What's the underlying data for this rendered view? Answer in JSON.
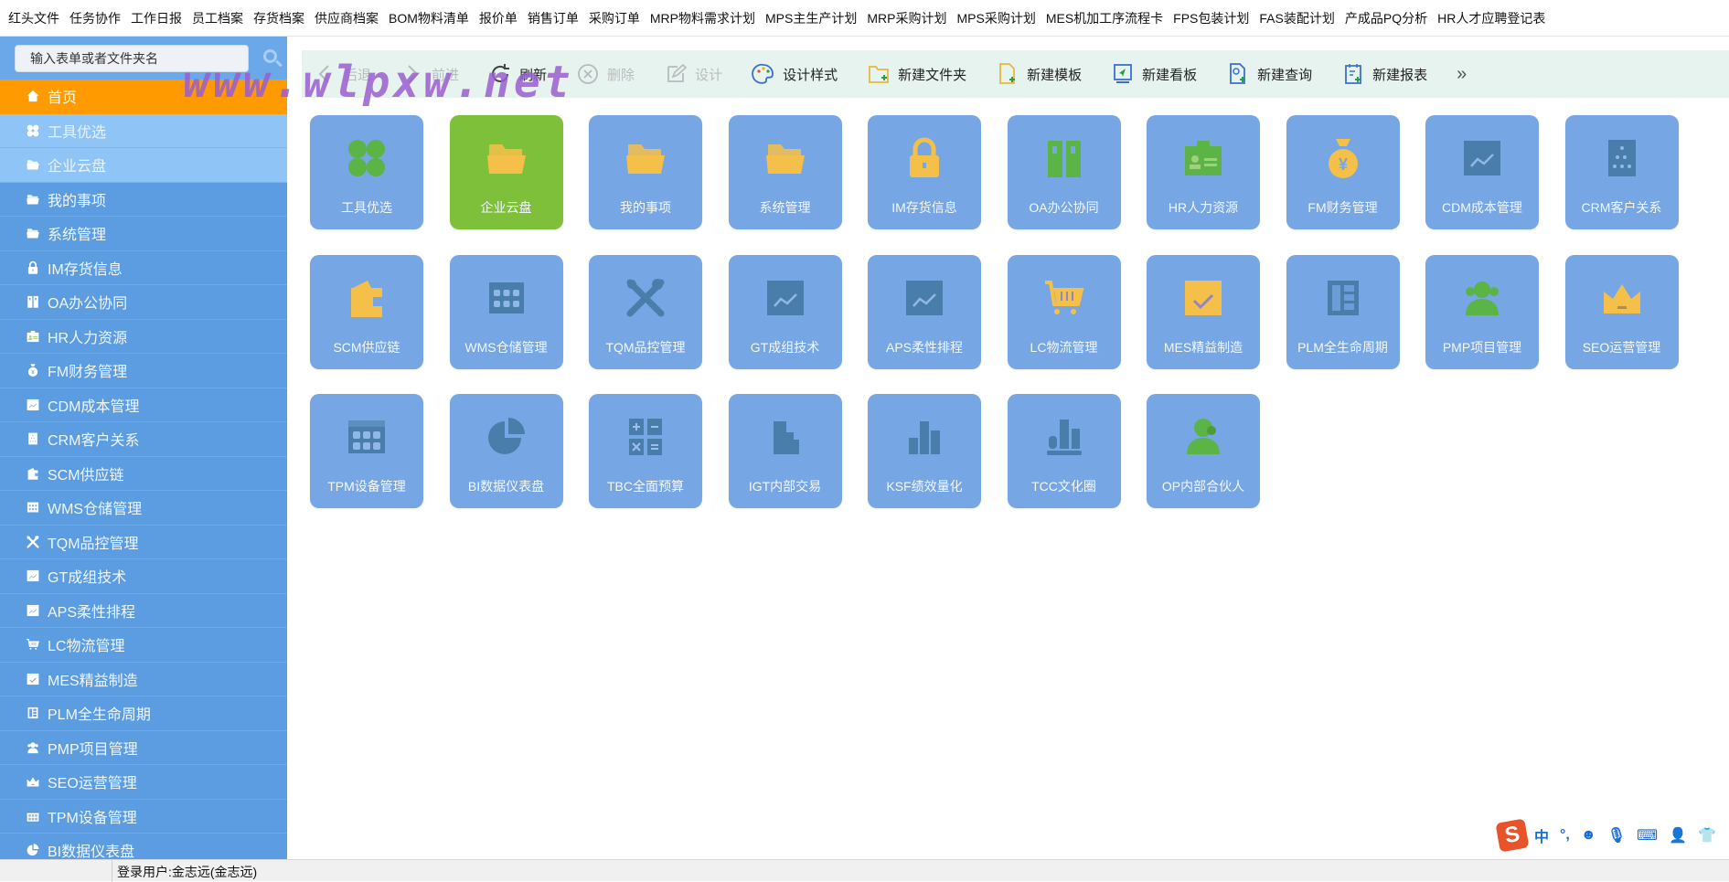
{
  "top_menu": [
    "红头文件",
    "任务协作",
    "工作日报",
    "员工档案",
    "存货档案",
    "供应商档案",
    "BOM物料清单",
    "报价单",
    "销售订单",
    "采购订单",
    "MRP物料需求计划",
    "MPS主生产计划",
    "MRP采购计划",
    "MPS采购计划",
    "MES机加工序流程卡",
    "FPS包装计划",
    "FAS装配计划",
    "产成品PQ分析",
    "HR人才应聘登记表"
  ],
  "search": {
    "placeholder": "输入表单或者文件夹名",
    "icon": "search-icon"
  },
  "sidebar": {
    "items": [
      {
        "label": "首页",
        "icon": "home-icon",
        "state": "active"
      },
      {
        "label": "工具优选",
        "icon": "grid-icon",
        "state": "light"
      },
      {
        "label": "企业云盘",
        "icon": "folder-icon",
        "state": "light"
      },
      {
        "label": "我的事项",
        "icon": "folder-icon",
        "state": "normal"
      },
      {
        "label": "系统管理",
        "icon": "folder-icon",
        "state": "normal"
      },
      {
        "label": "IM存货信息",
        "icon": "lock-icon",
        "state": "normal"
      },
      {
        "label": "OA办公协同",
        "icon": "binder-icon",
        "state": "normal"
      },
      {
        "label": "HR人力资源",
        "icon": "id-card-icon",
        "state": "normal"
      },
      {
        "label": "FM财务管理",
        "icon": "money-bag-icon",
        "state": "normal"
      },
      {
        "label": "CDM成本管理",
        "icon": "calendar-chart-icon",
        "state": "normal"
      },
      {
        "label": "CRM客户关系",
        "icon": "building-icon",
        "state": "normal"
      },
      {
        "label": "SCM供应链",
        "icon": "wallet-icon",
        "state": "normal"
      },
      {
        "label": "WMS仓储管理",
        "icon": "warehouse-icon",
        "state": "normal"
      },
      {
        "label": "TQM品控管理",
        "icon": "tools-icon",
        "state": "normal"
      },
      {
        "label": "GT成组技术",
        "icon": "calendar-chart-icon",
        "state": "normal"
      },
      {
        "label": "APS柔性排程",
        "icon": "calendar-chart-icon",
        "state": "normal"
      },
      {
        "label": "LC物流管理",
        "icon": "cart-icon",
        "state": "normal"
      },
      {
        "label": "MES精益制造",
        "icon": "calendar-check-icon",
        "state": "normal"
      },
      {
        "label": "PLM全生命周期",
        "icon": "layout-icon",
        "state": "normal"
      },
      {
        "label": "PMP项目管理",
        "icon": "user-group-icon",
        "state": "normal"
      },
      {
        "label": "SEO运营管理",
        "icon": "crown-icon",
        "state": "normal"
      },
      {
        "label": "TPM设备管理",
        "icon": "keypad-icon",
        "state": "normal"
      },
      {
        "label": "BI数据仪表盘",
        "icon": "pie-chart-icon",
        "state": "normal"
      }
    ]
  },
  "toolbar": {
    "buttons": [
      {
        "label": "后退",
        "icon": "chevron-left-icon",
        "disabled": true
      },
      {
        "label": "前进",
        "icon": "chevron-right-icon",
        "disabled": true
      },
      {
        "label": "刷新",
        "icon": "refresh-icon",
        "disabled": false
      },
      {
        "label": "删除",
        "icon": "delete-icon",
        "disabled": true
      },
      {
        "label": "设计",
        "icon": "edit-icon",
        "disabled": true
      },
      {
        "label": "设计样式",
        "icon": "palette-icon",
        "disabled": false
      },
      {
        "label": "新建文件夹",
        "icon": "new-folder-icon",
        "disabled": false
      },
      {
        "label": "新建模板",
        "icon": "new-template-icon",
        "disabled": false
      },
      {
        "label": "新建看板",
        "icon": "new-board-icon",
        "disabled": false
      },
      {
        "label": "新建查询",
        "icon": "new-query-icon",
        "disabled": false
      },
      {
        "label": "新建报表",
        "icon": "new-report-icon",
        "disabled": false
      }
    ],
    "more": "»"
  },
  "tiles": [
    {
      "label": "工具优选",
      "icon": "clover-icon",
      "color": "#5cb346",
      "bg": "blue"
    },
    {
      "label": "企业云盘",
      "icon": "folder-icon",
      "color": "#f5c04a",
      "bg": "green"
    },
    {
      "label": "我的事项",
      "icon": "folder-icon",
      "color": "#f5c04a",
      "bg": "blue"
    },
    {
      "label": "系统管理",
      "icon": "folder-icon",
      "color": "#f5c04a",
      "bg": "blue"
    },
    {
      "label": "IM存货信息",
      "icon": "lock-icon",
      "color": "#f5c04a",
      "bg": "blue"
    },
    {
      "label": "OA办公协同",
      "icon": "binder-icon",
      "color": "#5cb346",
      "bg": "blue"
    },
    {
      "label": "HR人力资源",
      "icon": "id-card-icon",
      "color": "#5cb346",
      "bg": "blue"
    },
    {
      "label": "FM财务管理",
      "icon": "money-bag-icon",
      "color": "#f5c04a",
      "bg": "blue"
    },
    {
      "label": "CDM成本管理",
      "icon": "calendar-chart-icon",
      "color": "#4a7eaa",
      "bg": "blue"
    },
    {
      "label": "CRM客户关系",
      "icon": "building-icon",
      "color": "#4a7eaa",
      "bg": "blue"
    },
    {
      "label": "SCM供应链",
      "icon": "wallet-icon",
      "color": "#f5c04a",
      "bg": "blue"
    },
    {
      "label": "WMS仓储管理",
      "icon": "warehouse-icon",
      "color": "#4a7eaa",
      "bg": "blue"
    },
    {
      "label": "TQM品控管理",
      "icon": "tools-icon",
      "color": "#4a7eaa",
      "bg": "blue"
    },
    {
      "label": "GT成组技术",
      "icon": "calendar-chart-icon",
      "color": "#4a7eaa",
      "bg": "blue"
    },
    {
      "label": "APS柔性排程",
      "icon": "calendar-chart-icon",
      "color": "#4a7eaa",
      "bg": "blue"
    },
    {
      "label": "LC物流管理",
      "icon": "cart-icon",
      "color": "#f5c04a",
      "bg": "blue"
    },
    {
      "label": "MES精益制造",
      "icon": "calendar-check-icon",
      "color": "#f5c04a",
      "bg": "blue"
    },
    {
      "label": "PLM全生命周期",
      "icon": "layout-icon",
      "color": "#4a7eaa",
      "bg": "blue"
    },
    {
      "label": "PMP项目管理",
      "icon": "user-group-icon",
      "color": "#5cb346",
      "bg": "blue"
    },
    {
      "label": "SEO运营管理",
      "icon": "crown-icon",
      "color": "#f5c04a",
      "bg": "blue"
    },
    {
      "label": "TPM设备管理",
      "icon": "keypad-icon",
      "color": "#4a7eaa",
      "bg": "blue"
    },
    {
      "label": "BI数据仪表盘",
      "icon": "pie-chart-icon",
      "color": "#4a7eaa",
      "bg": "blue"
    },
    {
      "label": "TBC全面预算",
      "icon": "calculator-icon",
      "color": "#4a7eaa",
      "bg": "blue"
    },
    {
      "label": "IGT内部交易",
      "icon": "buildings-icon",
      "color": "#4a7eaa",
      "bg": "blue"
    },
    {
      "label": "KSF绩效量化",
      "icon": "bar-chart-icon",
      "color": "#4a7eaa",
      "bg": "blue"
    },
    {
      "label": "TCC文化圈",
      "icon": "bar-chart-base-icon",
      "color": "#4a7eaa",
      "bg": "blue"
    },
    {
      "label": "OP内部合伙人",
      "icon": "partner-icon",
      "color": "#5cb346",
      "bg": "blue"
    }
  ],
  "watermark": "www.wlpxw.net",
  "status": {
    "user": "登录用户:金志远(金志远)"
  },
  "ime": {
    "logo": "S",
    "items": [
      "中",
      "°,",
      "☻",
      "🎙",
      "⌨",
      "👤",
      "👕"
    ]
  },
  "colors": {
    "sidebar": "#5b9de0",
    "active": "#ff9a00",
    "tile": "#77a6e4",
    "tile_active": "#7fc03a",
    "toolbar": "#e6f3ef"
  }
}
